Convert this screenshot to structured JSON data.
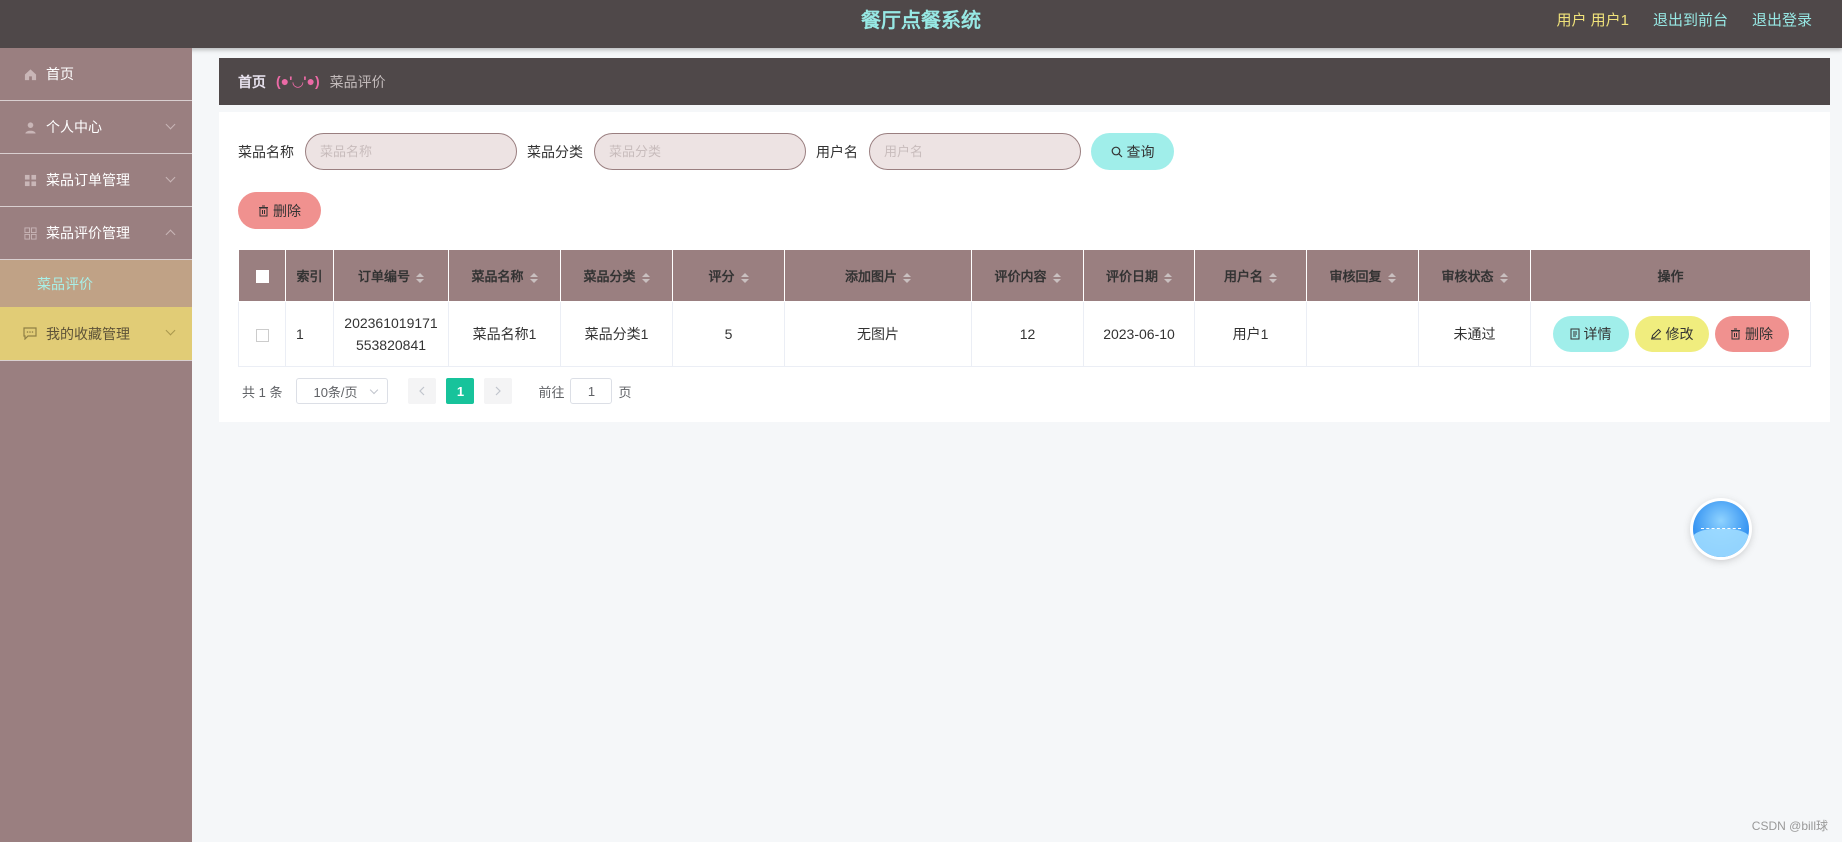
{
  "header": {
    "title": "餐厅点餐系统",
    "user_label": "用户 用户1",
    "back_frontend": "退出到前台",
    "logout": "退出登录"
  },
  "sidebar": {
    "items": [
      {
        "label": "首页",
        "icon": "home-icon"
      },
      {
        "label": "个人中心",
        "icon": "user-icon"
      },
      {
        "label": "菜品订单管理",
        "icon": "grid-icon"
      },
      {
        "label": "菜品评价管理",
        "icon": "grid-icon"
      },
      {
        "label": "我的收藏管理",
        "icon": "chat-icon"
      }
    ],
    "active_sub": "菜品评价"
  },
  "breadcrumb": {
    "home": "首页",
    "separator": "(●'◡'●)",
    "current": "菜品评价"
  },
  "search": {
    "name_label": "菜品名称",
    "name_placeholder": "菜品名称",
    "category_label": "菜品分类",
    "category_placeholder": "菜品分类",
    "user_label": "用户名",
    "user_placeholder": "用户名",
    "query_button": "查询"
  },
  "toolbar": {
    "delete_button": "删除"
  },
  "table": {
    "columns": [
      "索引",
      "订单编号",
      "菜品名称",
      "菜品分类",
      "评分",
      "添加图片",
      "评价内容",
      "评价日期",
      "用户名",
      "审核回复",
      "审核状态",
      "操作"
    ],
    "rows": [
      {
        "index": "1",
        "order_no_line1": "202361019171",
        "order_no_line2": "553820841",
        "dish_name": "菜品名称1",
        "dish_category": "菜品分类1",
        "score": "5",
        "image": "无图片",
        "content": "12",
        "date": "2023-06-10",
        "username": "用户1",
        "reply": "",
        "status": "未通过"
      }
    ],
    "op_detail": "详情",
    "op_edit": "修改",
    "op_delete": "删除"
  },
  "pager": {
    "total": "共 1 条",
    "page_size": "10条/页",
    "current_page": "1",
    "goto_prefix": "前往",
    "goto_value": "1",
    "goto_suffix": "页"
  },
  "watermark": "CSDN @bill球"
}
